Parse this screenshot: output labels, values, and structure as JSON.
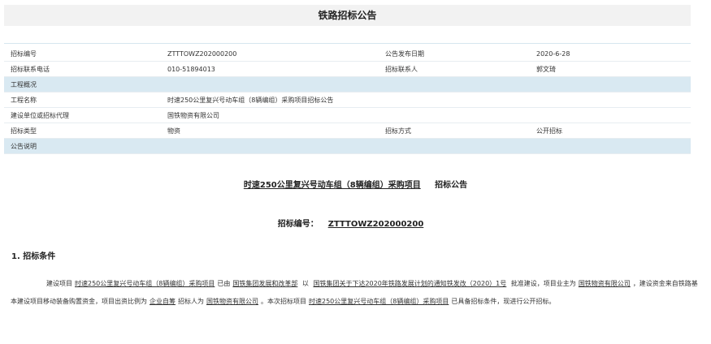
{
  "header": {
    "title": "铁路招标公告"
  },
  "info": {
    "bid_no_label": "招标编号",
    "bid_no": "ZTTTOWZ202000200",
    "publish_date_label": "公告发布日期",
    "publish_date": "2020-6-28",
    "phone_label": "招标联系电话",
    "phone": "010-51894013",
    "contact_label": "招标联系人",
    "contact": "郭文琦",
    "overview_label": "工程概况",
    "project_name_label": "工程名称",
    "project_name": "时速250公里复兴号动车组（8辆编组）采购项目招标公告",
    "agent_label": "建设单位或招标代理",
    "agent": "国铁物资有限公司",
    "type_label": "招标类型",
    "type": "物资",
    "method_label": "招标方式",
    "method": "公开招标",
    "notice_label": "公告说明"
  },
  "doc": {
    "title_main": "时速250公里复兴号动车组（8辆编组）采购项目",
    "title_suffix": "招标公告",
    "bid_no_prefix": "招标编号：",
    "bid_no_value": "ZTTTOWZ202000200",
    "section1": "1. 招标条件",
    "p": {
      "t1": "建设项目",
      "u1": "时速250公里复兴号动车组（8辆编组）采购项目",
      "t2": "已由",
      "u2": "国铁集团发展和改革部",
      "t3": "以",
      "u3": "国铁集团关于下达2020年铁路发展计划的通知铁发改（2020）1号",
      "t4": "批准建设，项目业主为",
      "u4": "国铁物资有限公司",
      "t5": "，建设资金来自铁路基本建设项目移动装备购置资金，项目出资比例为",
      "u5": "企业自筹",
      "t6": "招标人为",
      "u6": "国铁物资有限公司",
      "t7": "。本次招标项目",
      "u7": "时速250公里复兴号动车组（8辆编组）采购项目",
      "t8": "已具备招标条件，现进行公开招标。"
    }
  }
}
